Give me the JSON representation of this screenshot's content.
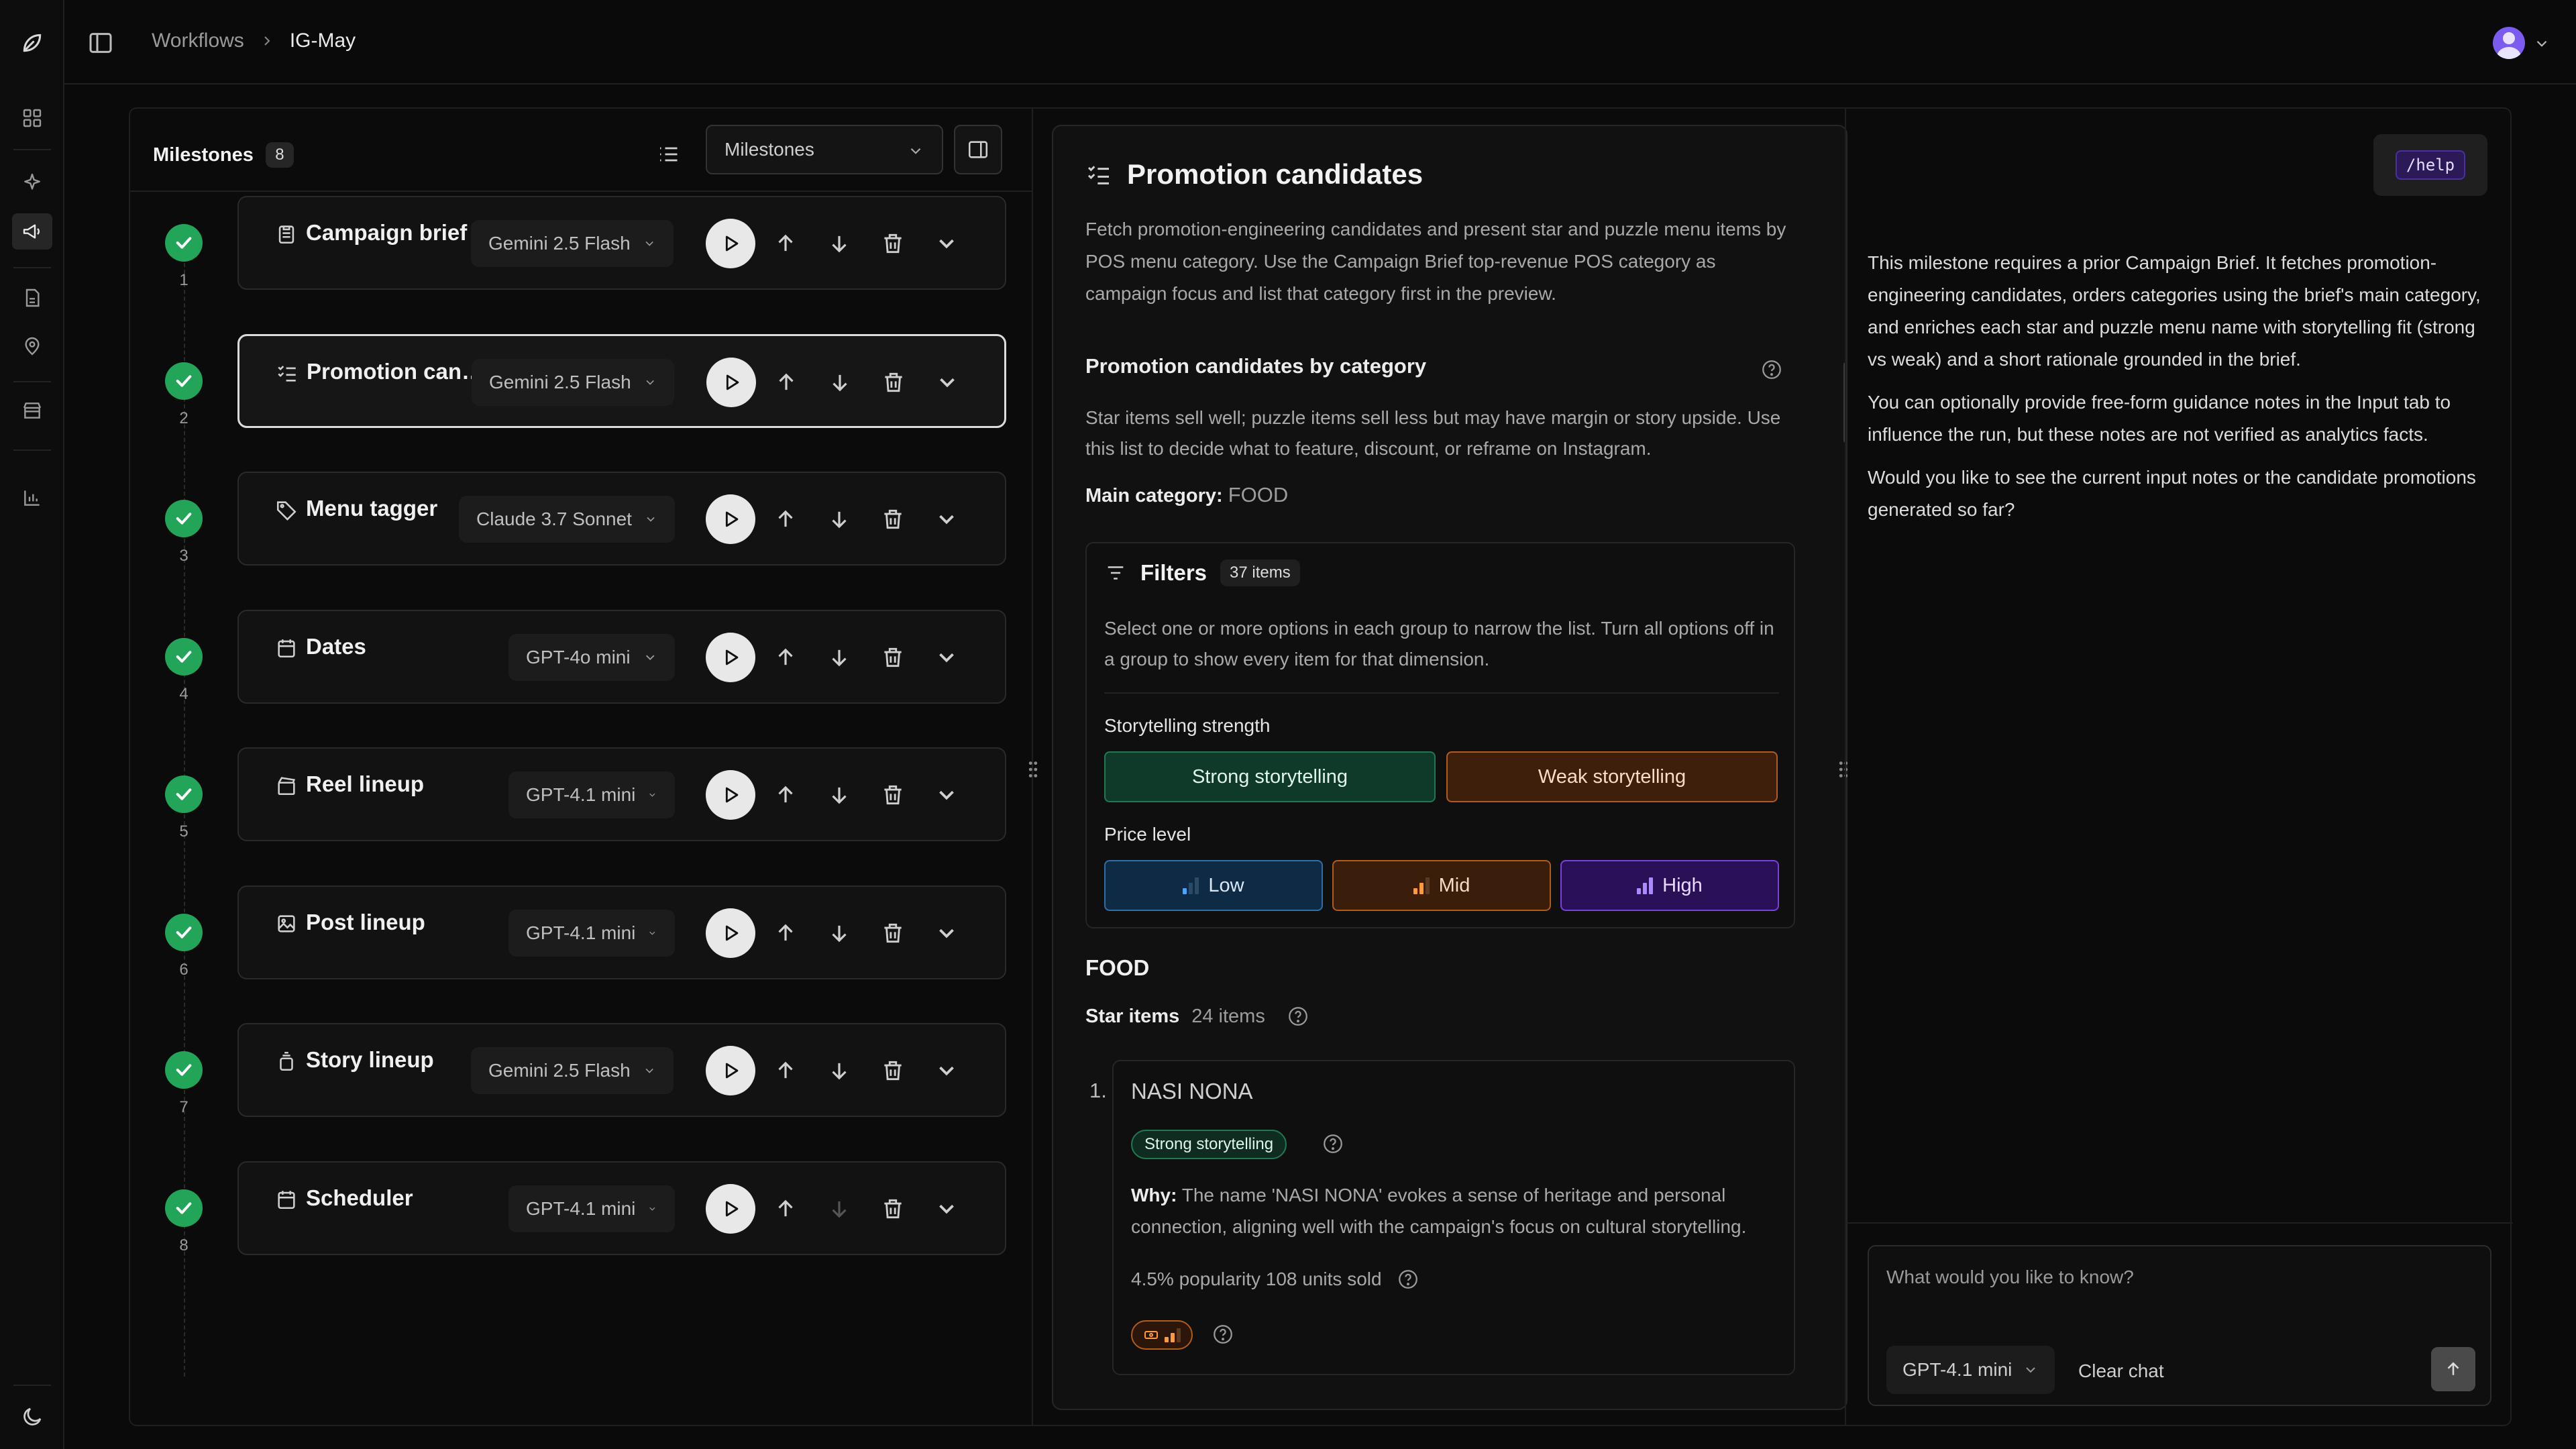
{
  "breadcrumbs": {
    "parent": "Workflows",
    "current": "IG-May"
  },
  "milestones_panel": {
    "title": "Milestones",
    "count": "8",
    "view_select": "Milestones",
    "items": [
      {
        "num": "1",
        "name": "Campaign brief",
        "model": "Gemini 2.5 Flash",
        "icon": "clipboard-icon"
      },
      {
        "num": "2",
        "name": "Promotion can…",
        "model": "Gemini 2.5 Flash",
        "icon": "checklist-icon",
        "selected": true
      },
      {
        "num": "3",
        "name": "Menu tagger",
        "model": "Claude 3.7 Sonnet",
        "icon": "tag-icon"
      },
      {
        "num": "4",
        "name": "Dates",
        "model": "GPT-4o mini",
        "icon": "calendar-icon"
      },
      {
        "num": "5",
        "name": "Reel lineup",
        "model": "GPT-4.1 mini",
        "icon": "clapperboard-icon"
      },
      {
        "num": "6",
        "name": "Post lineup",
        "model": "GPT-4.1 mini",
        "icon": "image-icon"
      },
      {
        "num": "7",
        "name": "Story lineup",
        "model": "Gemini 2.5 Flash",
        "icon": "stack-icon"
      },
      {
        "num": "8",
        "name": "Scheduler",
        "model": "GPT-4.1 mini",
        "icon": "calendar-icon"
      }
    ]
  },
  "detail": {
    "title": "Promotion candidates",
    "description": "Fetch promotion-engineering candidates and present star and puzzle menu items by POS menu category. Use the Campaign Brief top-revenue POS category as campaign focus and list that category first in the preview.",
    "section_title": "Promotion candidates by category",
    "section_desc": "Star items sell well; puzzle items sell less but may have margin or story upside. Use this list to decide what to feature, discount, or reframe on Instagram.",
    "main_category_label": "Main category:",
    "main_category_value": "FOOD",
    "filters": {
      "title": "Filters",
      "count": "37 items",
      "desc": "Select one or more options in each group to narrow the list. Turn all options off in a group to show every item for that dimension.",
      "storytelling_label": "Storytelling strength",
      "strong": "Strong storytelling",
      "weak": "Weak storytelling",
      "price_label": "Price level",
      "low": "Low",
      "mid": "Mid",
      "high": "High"
    },
    "category": "FOOD",
    "star_label": "Star items",
    "star_count": "24 items",
    "item": {
      "index": "1.",
      "name": "NASI NONA",
      "tag": "Strong storytelling",
      "why_label": "Why:",
      "why_text": "The name 'NASI NONA' evokes a sense of heritage and personal connection, aligning well with the campaign's focus on cultural storytelling.",
      "stats": "4.5% popularity 108 units sold"
    }
  },
  "chat": {
    "help_label": "/help",
    "messages": [
      "This milestone requires a prior Campaign Brief. It fetches promotion-engineering candidates, orders categories using the brief's main category, and enriches each star and puzzle menu name with storytelling fit (strong vs weak) and a short rationale grounded in the brief.",
      "You can optionally provide free-form guidance notes in the Input tab to influence the run, but these notes are not verified as analytics facts.",
      "Would you like to see the current input notes or the candidate promotions generated so far?"
    ],
    "placeholder": "What would you like to know?",
    "model": "GPT-4.1 mini",
    "clear_label": "Clear chat"
  },
  "colors": {
    "success": "#23a559",
    "accent": "#7c5cf0",
    "strong": "#1f7a52",
    "weak": "#b35a1e",
    "low": "#2f6ea8",
    "high": "#7a3fe0"
  }
}
